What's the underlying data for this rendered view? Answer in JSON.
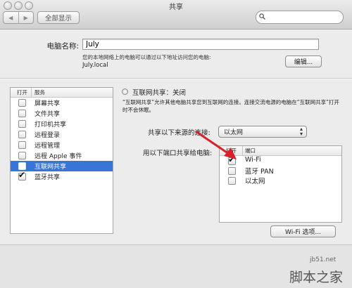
{
  "window": {
    "title": "共享"
  },
  "toolbar": {
    "back_icon": "◀",
    "forward_icon": "▶",
    "show_all_label": "全部显示",
    "search_placeholder": ""
  },
  "computer_name": {
    "label": "电脑名称:",
    "value": "July",
    "hint": "您的本地网络上的电脑可以通过以下地址访问您的电脑:",
    "address": "July.local",
    "edit_label": "编辑..."
  },
  "services": {
    "header_on": "打开",
    "header_service": "服务",
    "items": [
      {
        "label": "屏幕共享",
        "checked": false,
        "selected": false
      },
      {
        "label": "文件共享",
        "checked": false,
        "selected": false
      },
      {
        "label": "打印机共享",
        "checked": false,
        "selected": false
      },
      {
        "label": "远程登录",
        "checked": false,
        "selected": false
      },
      {
        "label": "远程管理",
        "checked": false,
        "selected": false
      },
      {
        "label": "远程 Apple 事件",
        "checked": false,
        "selected": false
      },
      {
        "label": "互联网共享",
        "checked": false,
        "selected": true
      },
      {
        "label": "蓝牙共享",
        "checked": true,
        "selected": false
      }
    ]
  },
  "internet_sharing": {
    "status": "互联网共享：关闭",
    "description": "“互联网共享”允许其他电脑共享您到互联网的连接。连接交流电源的电脑在“互联网共享”打开时不会休眠。",
    "source_label": "共享以下来源的连接:",
    "source_value": "以太网",
    "ports_label": "用以下端口共享给电脑:",
    "ports_header_on": "打开",
    "ports_header_port": "端口",
    "ports": [
      {
        "label": "Wi-Fi",
        "checked": true
      },
      {
        "label": "蓝牙 PAN",
        "checked": false
      },
      {
        "label": "以太网",
        "checked": false
      }
    ],
    "wifi_options_label": "Wi-Fi 选项..."
  },
  "watermark": {
    "line1": "jb51.net",
    "line2": "脚本之家"
  }
}
